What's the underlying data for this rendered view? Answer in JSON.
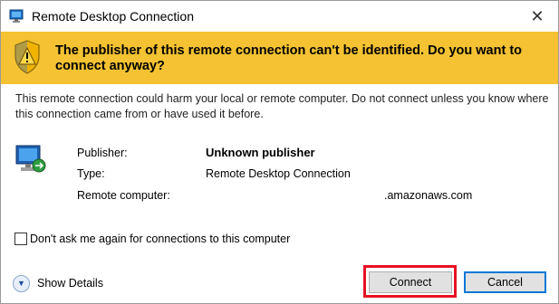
{
  "window": {
    "title": "Remote Desktop Connection",
    "close_symbol": "✕"
  },
  "warning": {
    "message": "The publisher of this remote connection can't be identified. Do you want to connect anyway?"
  },
  "description": "This remote connection could harm your local or remote computer. Do not connect unless you know where this connection came from or have used it before.",
  "details": {
    "publisher_label": "Publisher:",
    "publisher_value": "Unknown publisher",
    "type_label": "Type:",
    "type_value": "Remote Desktop Connection",
    "remote_label": "Remote computer:",
    "remote_value": ".amazonaws.com"
  },
  "checkbox": {
    "label": "Don't ask me again for connections to this computer",
    "checked": false
  },
  "footer": {
    "show_details_label": "Show Details",
    "connect_label": "Connect",
    "cancel_label": "Cancel"
  },
  "icons": {
    "app": "remote-desktop-icon",
    "warning": "warning-shield-icon",
    "computer": "remote-computer-icon",
    "expand": "chevron-down-icon"
  },
  "colors": {
    "warning_bar": "#f4c232",
    "highlight": "#e81123",
    "focus_border": "#0078d7"
  }
}
